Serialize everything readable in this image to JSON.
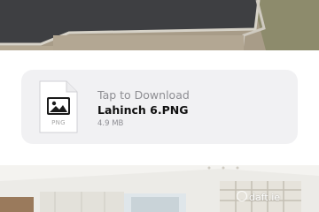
{
  "attachment": {
    "action_label": "Tap to Download",
    "file_name": "Lahinch 6.PNG",
    "file_size": "4.9 MB",
    "file_type": "PNG",
    "icon": "image-icon"
  },
  "watermark": {
    "text": "daft.ie"
  }
}
